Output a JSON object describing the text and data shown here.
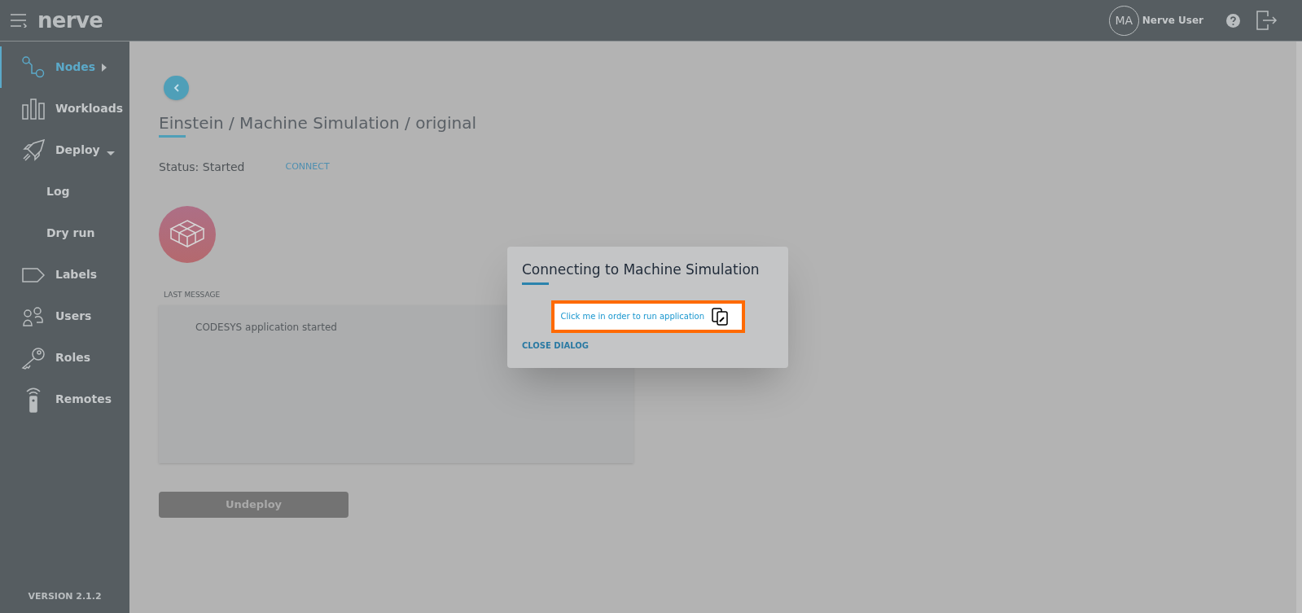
{
  "header": {
    "logo": "nerve",
    "user_initials": "MA",
    "user_name": "Nerve User"
  },
  "sidebar": {
    "items": [
      {
        "label": "Nodes",
        "kind": "main",
        "selected": true
      },
      {
        "label": "Workloads",
        "kind": "main",
        "selected": false
      },
      {
        "label": "Deploy",
        "kind": "main",
        "selected": false
      },
      {
        "label": "Log",
        "kind": "sub",
        "selected": false
      },
      {
        "label": "Dry run",
        "kind": "sub",
        "selected": false
      },
      {
        "label": "Labels",
        "kind": "main",
        "selected": false
      },
      {
        "label": "Users",
        "kind": "main",
        "selected": false
      },
      {
        "label": "Roles",
        "kind": "main",
        "selected": false
      },
      {
        "label": "Remotes",
        "kind": "main",
        "selected": false
      }
    ],
    "version": "VERSION 2.1.2"
  },
  "page": {
    "title": "Einstein / Machine Simulation / original",
    "status": "Status: Started",
    "connect": "CONNECT",
    "last_message_label": "LAST MESSAGE",
    "last_message": "CODESYS application started",
    "undeploy": "Undeploy"
  },
  "dialog": {
    "title": "Connecting to Machine Simulation",
    "link": "Click me in order to run application",
    "close": "CLOSE DIALOG"
  }
}
